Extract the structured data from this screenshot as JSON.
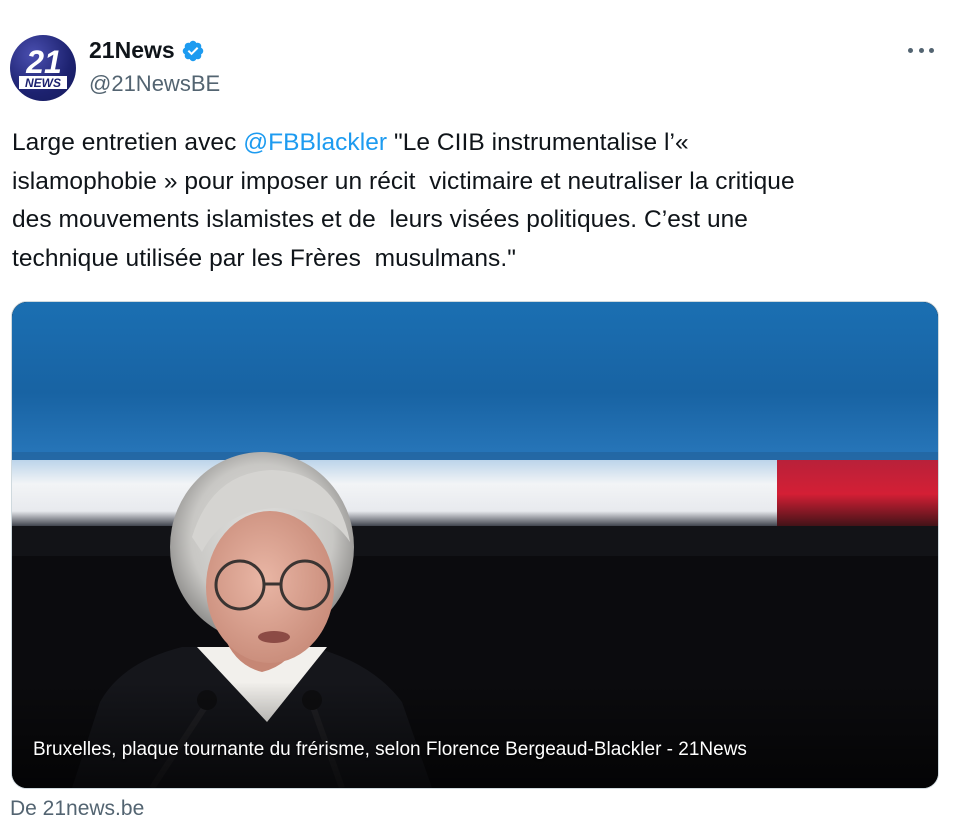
{
  "account": {
    "display_name": "21News",
    "handle": "@21NewsBE",
    "verified": true,
    "avatar_text_number": "21",
    "avatar_text_word": "NEWS",
    "verified_color": "#1d9bf0"
  },
  "tweet": {
    "lines": [
      {
        "before": "Large entretien avec ",
        "mention": "@FBBlackler",
        "after": " \"Le CIIB instrumentalise l’«"
      },
      {
        "text": "islamophobie » pour imposer un récit  victimaire et neutraliser la critique"
      },
      {
        "text": "des mouvements islamistes et de  leurs visées politiques. C’est une"
      },
      {
        "text": "technique utilisée par les Frères  musulmans.\""
      }
    ],
    "mention_color": "#1d9bf0"
  },
  "card": {
    "caption": "Bruxelles, plaque tournante du frérisme, selon Florence Bergeaud-Blackler - 21News",
    "source": "De 21news.be"
  },
  "icons": {
    "more": "more-options-icon",
    "verified": "verified-badge-icon"
  }
}
